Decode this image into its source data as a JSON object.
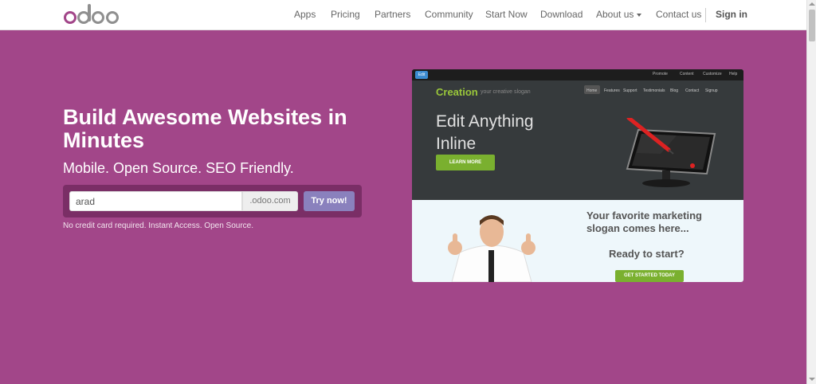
{
  "nav": {
    "logo_alt": "odoo",
    "items": [
      {
        "label": "Apps"
      },
      {
        "label": "Pricing"
      },
      {
        "label": "Partners"
      },
      {
        "label": "Community"
      },
      {
        "label": "Start Now"
      },
      {
        "label": "Download"
      },
      {
        "label": "About us"
      },
      {
        "label": "Contact us"
      }
    ],
    "sign_in": "Sign in"
  },
  "hero": {
    "title": "Build Awesome Websites in Minutes",
    "subtitle": "Mobile. Open Source. SEO Friendly.",
    "input_value": "arad",
    "domain_suffix": ".odoo.com",
    "try_button": "Try now!",
    "note": "No credit card required. Instant Access. Open Source."
  },
  "preview": {
    "edit_button": "Edit",
    "top_links": [
      "Promote",
      "Content",
      "Customize",
      "Help"
    ],
    "brand": "Creation",
    "slogan": "your creative slogan",
    "menu": [
      "Home",
      "Features",
      "Support",
      "Testimonials",
      "Blog",
      "Contact",
      "Signup"
    ],
    "headline": "Edit Anything Inline",
    "learn_more": "LEARN MORE",
    "marketing": "Your favorite marketing slogan comes here...",
    "ready": "Ready to start?",
    "get_started": "GET STARTED TODAY"
  },
  "colors": {
    "brand_purple": "#a24689",
    "button_violet": "#8a81bd",
    "preview_green": "#7ab02f"
  }
}
